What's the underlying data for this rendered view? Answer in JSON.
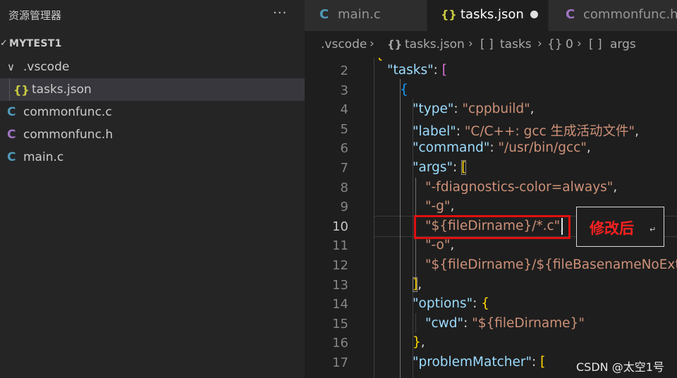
{
  "explorer": {
    "title": "资源管理器",
    "more": "···",
    "project": "MYTEST1",
    "items": [
      {
        "icon": "",
        "label": ".vscode",
        "chevron": "∨"
      },
      {
        "icon": "{}",
        "label": "tasks.json"
      },
      {
        "icon": "C",
        "label": "commonfunc.c"
      },
      {
        "icon": "C",
        "label": "commonfunc.h"
      },
      {
        "icon": "C",
        "label": "main.c"
      }
    ]
  },
  "tabs": [
    {
      "icon": "C",
      "label": "main.c"
    },
    {
      "icon": "{}",
      "label": "tasks.json",
      "modified": true
    },
    {
      "icon": "C",
      "label": "commonfunc.h"
    }
  ],
  "breadcrumb": [
    {
      "icon": "",
      "label": ".vscode"
    },
    {
      "icon": "{}",
      "label": "tasks.json"
    },
    {
      "icon": "[ ]",
      "label": "tasks"
    },
    {
      "icon": "{}",
      "label": "0"
    },
    {
      "icon": "[ ]",
      "label": "args"
    }
  ],
  "code": {
    "line_numbers": [
      "2",
      "3",
      "4",
      "5",
      "6",
      "7",
      "8",
      "9",
      "10",
      "11",
      "12",
      "13",
      "14",
      "15",
      "16",
      "17"
    ],
    "current_line": "10",
    "top_partial": "{",
    "l2_key": "\"tasks\"",
    "l2_rest": ": ",
    "l2_br": "[",
    "l3_br": "{",
    "l4_key": "\"type\"",
    "l4_p": ": ",
    "l4_val": "\"cppbuild\"",
    "l4_c": ",",
    "l5_key": "\"label\"",
    "l5_p": ": ",
    "l5_val": "\"C/C++: gcc 生成活动文件\"",
    "l5_c": ",",
    "l6_key": "\"command\"",
    "l6_p": ": ",
    "l6_val": "\"/usr/bin/gcc\"",
    "l6_c": ",",
    "l7_key": "\"args\"",
    "l7_p": ": ",
    "l7_br": "[",
    "l8_val": "\"-fdiagnostics-color=always\"",
    "l8_c": ",",
    "l9_val": "\"-g\"",
    "l9_c": ",",
    "l10_val": "\"${fileDirname}/*.c\"",
    "l10_c": ",",
    "l11_val": "\"-o\"",
    "l11_c": ",",
    "l12_val": "\"${fileDirname}/${fileBasenameNoExte",
    "l13_br": "]",
    "l13_c": ",",
    "l14_key": "\"options\"",
    "l14_p": ": ",
    "l14_br": "{",
    "l15_key": "\"cwd\"",
    "l15_p": ": ",
    "l15_val": "\"${fileDirname}\"",
    "l16_br": "}",
    "l16_c": ",",
    "l17_key": "\"problemMatcher\"",
    "l17_p": ": ",
    "l17_br": "["
  },
  "annotation": {
    "text": "修改后",
    "return_mark": "↵"
  },
  "watermark": "CSDN @太空1号",
  "colors": {
    "accent_c": "#519aba",
    "accent_h": "#a074c4",
    "json_icon": "#cbcb41",
    "highlight_box": "#e01010"
  }
}
